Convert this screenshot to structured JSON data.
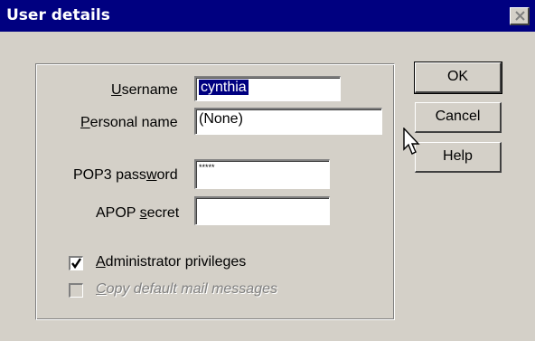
{
  "window": {
    "title": "User details",
    "close_icon": "close-icon"
  },
  "form": {
    "username": {
      "prefix": "",
      "underlined": "U",
      "rest": "sername",
      "value": "cynthia"
    },
    "personal_name": {
      "underlined": "P",
      "rest": "ersonal name",
      "value": "(None)"
    },
    "pop3_password": {
      "before": "POP3 pass",
      "underlined": "w",
      "after": "ord",
      "value": "*****"
    },
    "apop_secret": {
      "before": "APOP ",
      "underlined": "s",
      "after": "ecret",
      "value": ""
    }
  },
  "checkboxes": {
    "admin": {
      "underlined": "A",
      "rest": "dministrator privileges",
      "checked": true
    },
    "copy_mail": {
      "underlined": "C",
      "rest": "opy default mail messages",
      "checked": false,
      "disabled": true
    }
  },
  "buttons": {
    "ok": "OK",
    "cancel": "Cancel",
    "help": "Help"
  },
  "colors": {
    "titlebar": "#000080",
    "face": "#d4d0c8",
    "selection": "#000080"
  },
  "icons": [
    "close-icon",
    "checkmark-icon",
    "mouse-cursor-icon"
  ]
}
